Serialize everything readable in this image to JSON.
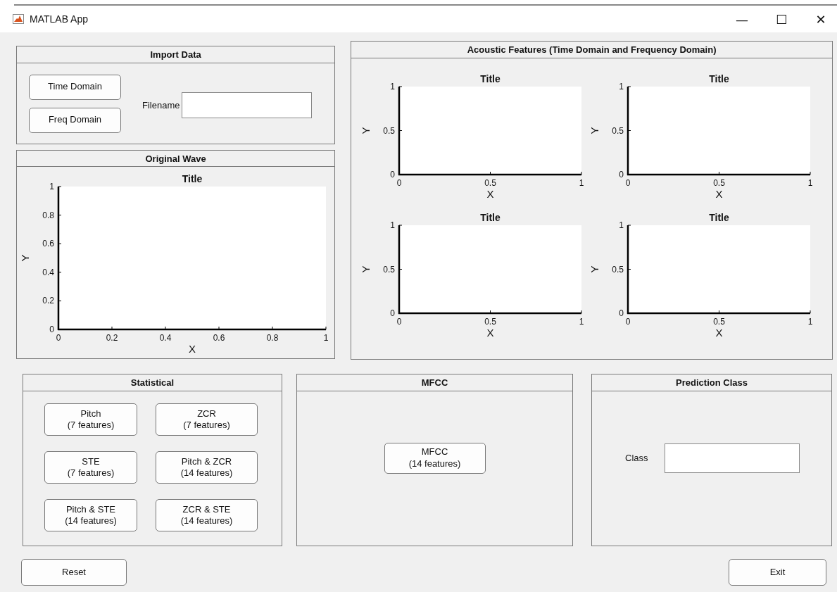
{
  "window": {
    "title": "MATLAB App",
    "controls": [
      "—",
      "☐",
      "✕"
    ]
  },
  "import_panel": {
    "title": "Import Data",
    "buttons": [
      "Time Domain",
      "Freq Domain"
    ],
    "filename_field": {
      "label": "Filename"
    }
  },
  "wave_panel": {
    "title": "Original Wave",
    "chart_data": {
      "type": "line",
      "title": "Title",
      "xlabel": "X",
      "ylabel": "Y",
      "xlim": [
        0,
        1
      ],
      "ylim": [
        0,
        1
      ],
      "xticks": [
        0,
        0.2,
        0.4,
        0.6,
        0.8,
        1
      ],
      "yticks": [
        0,
        0.2,
        0.4,
        0.6,
        0.8,
        1
      ]
    }
  },
  "acoustic_panel": {
    "title": "Acoustic Features (Time Domain and Frequency Domain)",
    "charts": [
      {
        "chart_data": {
          "type": "line",
          "title": "Title",
          "xlabel": "X",
          "ylabel": "Y",
          "xlim": [
            0,
            1
          ],
          "ylim": [
            0,
            1
          ],
          "xticks": [
            0,
            0.5,
            1
          ],
          "yticks": [
            0,
            0.5,
            1
          ]
        }
      },
      {
        "chart_data": {
          "type": "line",
          "title": "Title",
          "xlabel": "X",
          "ylabel": "Y",
          "xlim": [
            0,
            1
          ],
          "ylim": [
            0,
            1
          ],
          "xticks": [
            0,
            0.5,
            1
          ],
          "yticks": [
            0,
            0.5,
            1
          ]
        }
      },
      {
        "chart_data": {
          "type": "line",
          "title": "Title",
          "xlabel": "X",
          "ylabel": "Y",
          "xlim": [
            0,
            1
          ],
          "ylim": [
            0,
            1
          ],
          "xticks": [
            0,
            0.5,
            1
          ],
          "yticks": [
            0,
            0.5,
            1
          ]
        }
      },
      {
        "chart_data": {
          "type": "line",
          "title": "Title",
          "xlabel": "X",
          "ylabel": "Y",
          "xlim": [
            0,
            1
          ],
          "ylim": [
            0,
            1
          ],
          "xticks": [
            0,
            0.5,
            1
          ],
          "yticks": [
            0,
            0.5,
            1
          ]
        }
      }
    ]
  },
  "statistical_panel": {
    "title": "Statistical",
    "buttons": [
      "Pitch\n(7 features)",
      "ZCR\n(7 features)",
      "STE\n(7 features)",
      "Pitch & ZCR\n(14 features)",
      "Pitch & STE\n(14 features)",
      "ZCR & STE\n(14 features)"
    ]
  },
  "mfcc_panel": {
    "title": "MFCC",
    "buttons": [
      "MFCC\n(14 features)"
    ]
  },
  "prediction_panel": {
    "title": "Prediction Class",
    "class_field": {
      "label": "Class"
    }
  },
  "footer_buttons": [
    "Reset",
    "Exit"
  ]
}
